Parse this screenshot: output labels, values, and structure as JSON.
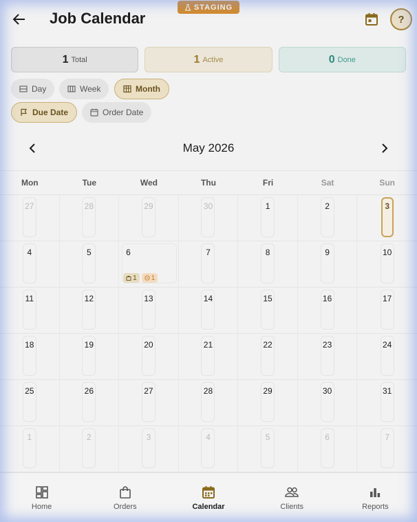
{
  "banner": {
    "env_label": "STAGING"
  },
  "header": {
    "title": "Job Calendar"
  },
  "stats": [
    {
      "count": "1",
      "label": "Total"
    },
    {
      "count": "1",
      "label": "Active"
    },
    {
      "count": "0",
      "label": "Done"
    }
  ],
  "view_modes": [
    {
      "label": "Day",
      "selected": false
    },
    {
      "label": "Week",
      "selected": false
    },
    {
      "label": "Month",
      "selected": true
    }
  ],
  "date_modes": [
    {
      "label": "Due Date",
      "selected": true
    },
    {
      "label": "Order Date",
      "selected": false
    }
  ],
  "calendar": {
    "month_label": "May 2026",
    "weekdays": [
      "Mon",
      "Tue",
      "Wed",
      "Thu",
      "Fri",
      "Sat",
      "Sun"
    ],
    "weeks": [
      [
        "27",
        "28",
        "29",
        "30",
        "1",
        "2",
        "3"
      ],
      [
        "4",
        "5",
        "6",
        "7",
        "8",
        "9",
        "10"
      ],
      [
        "11",
        "12",
        "13",
        "14",
        "15",
        "16",
        "17"
      ],
      [
        "18",
        "19",
        "20",
        "21",
        "22",
        "23",
        "24"
      ],
      [
        "25",
        "26",
        "27",
        "28",
        "29",
        "30",
        "31"
      ],
      [
        "1",
        "2",
        "3",
        "4",
        "5",
        "6",
        "7"
      ]
    ],
    "today": "3",
    "event_day": {
      "day": "6",
      "orders_count": "1",
      "active_count": "1"
    }
  },
  "bottom_nav": [
    {
      "label": "Home",
      "icon": "dashboard-icon",
      "active": false
    },
    {
      "label": "Orders",
      "icon": "shopping-bag-icon",
      "active": false
    },
    {
      "label": "Calendar",
      "icon": "calendar-icon",
      "active": true
    },
    {
      "label": "Clients",
      "icon": "people-icon",
      "active": false
    },
    {
      "label": "Reports",
      "icon": "bar-chart-icon",
      "active": false
    }
  ],
  "colors": {
    "accent": "#a07a2a",
    "staging": "#d48a2a",
    "done": "#2e8a80"
  }
}
